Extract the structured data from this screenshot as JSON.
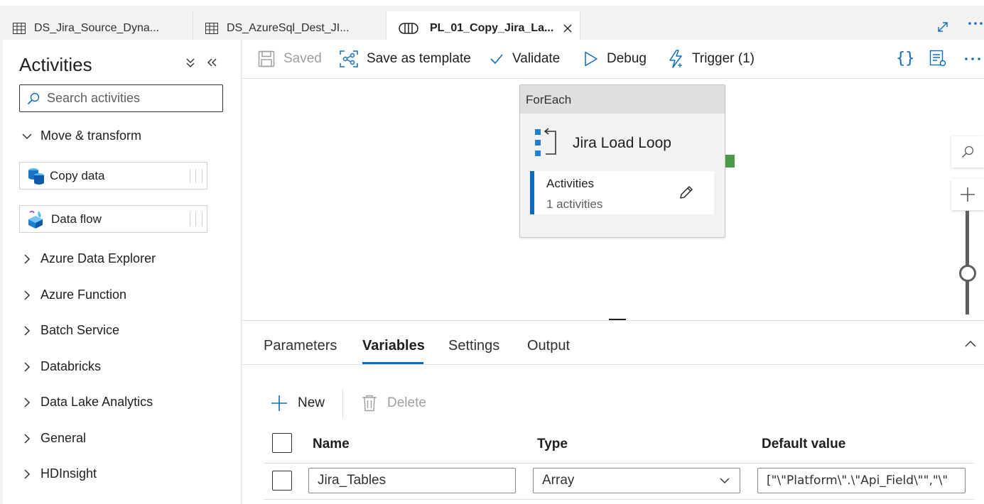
{
  "tabs": [
    {
      "label": "DS_Jira_Source_Dyna...",
      "icon": "table-icon"
    },
    {
      "label": "DS_AzureSql_Dest_JI...",
      "icon": "table-icon"
    },
    {
      "label": "PL_01_Copy_Jira_La...",
      "icon": "pipeline-icon",
      "active": true
    }
  ],
  "activities_panel": {
    "title": "Activities",
    "search_placeholder": "Search activities",
    "expanded_category": "Move & transform",
    "items": [
      {
        "label": "Copy data",
        "icon": "copy-data-icon"
      },
      {
        "label": "Data flow",
        "icon": "data-flow-icon"
      }
    ],
    "categories": [
      "Azure Data Explorer",
      "Azure Function",
      "Batch Service",
      "Databricks",
      "Data Lake Analytics",
      "General",
      "HDInsight"
    ]
  },
  "toolbar": {
    "saved_label": "Saved",
    "save_template_label": "Save as template",
    "validate_label": "Validate",
    "debug_label": "Debug",
    "trigger_label": "Trigger (1)"
  },
  "canvas": {
    "activity_type": "ForEach",
    "activity_name": "Jira Load Loop",
    "inner_title": "Activities",
    "inner_count": "1 activities"
  },
  "bottom_panel": {
    "tabs": [
      "Parameters",
      "Variables",
      "Settings",
      "Output"
    ],
    "active_tab": "Variables",
    "new_label": "New",
    "delete_label": "Delete",
    "columns": {
      "name": "Name",
      "type": "Type",
      "default": "Default value"
    },
    "rows": [
      {
        "name": "Jira_Tables",
        "type": "Array",
        "default": "[\"\\\"Platform\\\".\\\"Api_Field\\\"\",\"\\\""
      }
    ]
  },
  "colors": {
    "accent": "#0f6cbd",
    "success_port": "#4a9a4a",
    "tab_bg": "#f3f2f1"
  }
}
